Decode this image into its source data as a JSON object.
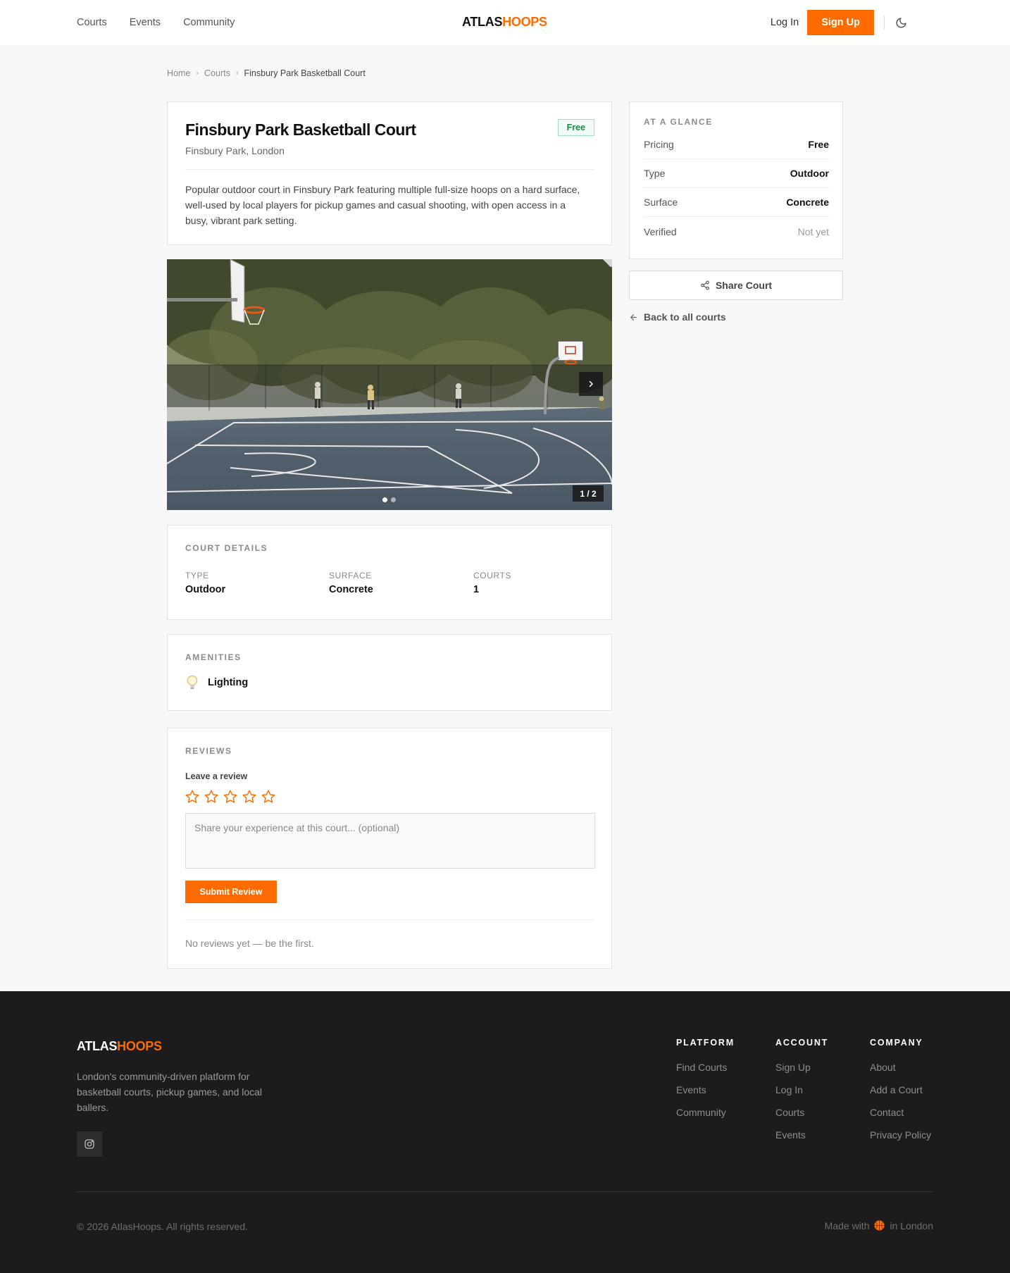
{
  "header": {
    "nav": [
      "Courts",
      "Events",
      "Community"
    ],
    "logo_part1": "ATLAS",
    "logo_part2": "HOOPS",
    "login_label": "Log In",
    "signup_label": "Sign Up"
  },
  "breadcrumb": [
    "Home",
    "Courts",
    "Finsbury Park Basketball Court"
  ],
  "court": {
    "title": "Finsbury Park Basketball Court",
    "location": "Finsbury Park, London",
    "badge": "Free",
    "description": "Popular outdoor court in Finsbury Park featuring multiple full-size hoops on a hard surface, well-used by local players for pickup games and casual shooting, with open access in a busy, vibrant park setting."
  },
  "gallery": {
    "counter": "1 / 2",
    "current": 1,
    "total": 2
  },
  "details": {
    "title": "COURT DETAILS",
    "items": [
      {
        "label": "TYPE",
        "value": "Outdoor"
      },
      {
        "label": "SURFACE",
        "value": "Concrete"
      },
      {
        "label": "COURTS",
        "value": "1"
      }
    ]
  },
  "amenities": {
    "title": "AMENITIES",
    "items": [
      {
        "label": "Lighting",
        "icon": "lightbulb-icon"
      }
    ]
  },
  "reviews": {
    "title": "REVIEWS",
    "leave_label": "Leave a review",
    "star_count": 5,
    "placeholder": "Share your experience at this court... (optional)",
    "submit_label": "Submit Review",
    "empty_text": "No reviews yet — be the first."
  },
  "glance": {
    "title": "AT A GLANCE",
    "rows": [
      {
        "key": "Pricing",
        "value": "Free"
      },
      {
        "key": "Type",
        "value": "Outdoor"
      },
      {
        "key": "Surface",
        "value": "Concrete"
      },
      {
        "key": "Verified",
        "value": "Not yet"
      }
    ]
  },
  "share_label": "Share Court",
  "back_label": "Back to all courts",
  "footer": {
    "logo_part1": "ATLAS",
    "logo_part2": "HOOPS",
    "description": "London's community-driven platform for basketball courts, pickup games, and local ballers.",
    "columns": [
      {
        "title": "PLATFORM",
        "links": [
          "Find Courts",
          "Events",
          "Community"
        ]
      },
      {
        "title": "ACCOUNT",
        "links": [
          "Sign Up",
          "Log In",
          "Courts",
          "Events"
        ]
      },
      {
        "title": "COMPANY",
        "links": [
          "About",
          "Add a Court",
          "Contact",
          "Privacy Policy"
        ]
      }
    ],
    "copyright": "© 2026 AtlasHoops. All rights reserved.",
    "made_prefix": "Made with",
    "made_suffix": "in London"
  },
  "colors": {
    "accent": "#ff6b00",
    "footer_bg": "#1c1b1d",
    "badge_green": "#1a8a4a"
  }
}
